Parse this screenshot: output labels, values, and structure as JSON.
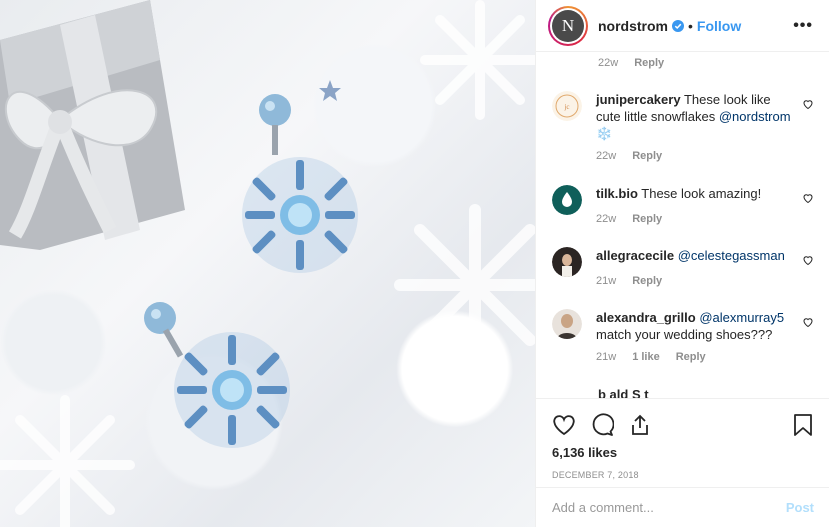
{
  "header": {
    "username": "nordstrom",
    "avatar_letter": "N",
    "verified_icon": "verified-badge-icon",
    "separator": "•",
    "follow_label": "Follow",
    "more_icon": "more-options-icon",
    "more_glyph": "•••"
  },
  "comments": {
    "top_meta": {
      "age": "22w",
      "reply_label": "Reply"
    },
    "items": [
      {
        "username": "junipercakery",
        "text": "These look like cute little snowflakes",
        "mention": "@nordstrom",
        "emoji": "❄️",
        "age": "22w",
        "reply_label": "Reply"
      },
      {
        "username": "tilk.bio",
        "text": "These look amazing!",
        "age": "22w",
        "reply_label": "Reply"
      },
      {
        "username": "allegracecile",
        "mention": "@celestegassman",
        "age": "21w",
        "reply_label": "Reply"
      },
      {
        "username": "alexandra_grillo",
        "mention": "@alexmurray5",
        "text": "match your wedding shoes???",
        "age": "21w",
        "likes_label": "1 like",
        "reply_label": "Reply"
      }
    ],
    "truncated_text": "b   ald S  t"
  },
  "actions": {
    "likes": "6,136 likes",
    "date": "DECEMBER 7, 2018"
  },
  "add_comment": {
    "placeholder": "Add a comment...",
    "post_label": "Post"
  },
  "colors": {
    "accent": "#3897f0",
    "post_disabled": "#b2dffc",
    "muted": "#8e8e8e",
    "text": "#262626"
  }
}
